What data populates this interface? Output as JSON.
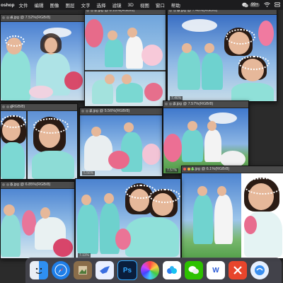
{
  "menubar": {
    "app": "oshop",
    "items": [
      "文件",
      "编辑",
      "图像",
      "图层",
      "文字",
      "选择",
      "滤镜",
      "3D",
      "视图",
      "窗口",
      "帮助"
    ],
    "wechat_badge": "99+"
  },
  "windows": [
    {
      "title": "4.jpg @ 7.52%(RGB/8)",
      "zoom": ""
    },
    {
      "title": "7.jpg @ 8.18%(RGB/8)",
      "zoom": ""
    },
    {
      "title": "8.jpg @ 7.46%(RGB/8)",
      "zoom": "7.46%"
    },
    {
      "title": "2.jpg @ 5.56%(RGB/8)",
      "zoom": "5.56%"
    },
    {
      "title": "3.jpg @ 7.57%(RGB/8)",
      "zoom": "7.57%"
    },
    {
      "title": "1.jpg @ 6.1%(RGB/8)",
      "zoom": ""
    },
    {
      "title": "5.jpg @ 6.85%(RGB/8)",
      "zoom": ""
    },
    {
      "title": "6.jpg @ 7.11%(RGB/8)",
      "zoom": "7.11%"
    },
    {
      "title": "(RGB/8)",
      "zoom": ""
    }
  ],
  "dock": {
    "apps": [
      {
        "name": "finder",
        "color": "#2f8ff0"
      },
      {
        "name": "safari",
        "color": "#1e7ee8"
      },
      {
        "name": "preview",
        "color": "#8a6d4a"
      },
      {
        "name": "feishu",
        "color": "#3b6fe0"
      },
      {
        "name": "photoshop",
        "color": "#0a1e3c",
        "label": "Ps"
      },
      {
        "name": "color-app",
        "color": "#ffffff"
      },
      {
        "name": "baidu-netdisk",
        "color": "#ffffff"
      },
      {
        "name": "wechat",
        "color": "#2dc100"
      },
      {
        "name": "wps",
        "color": "#ffffff",
        "label": "W"
      },
      {
        "name": "xmind",
        "color": "#e8452c"
      },
      {
        "name": "browser",
        "color": "#3a8ff0"
      }
    ]
  }
}
